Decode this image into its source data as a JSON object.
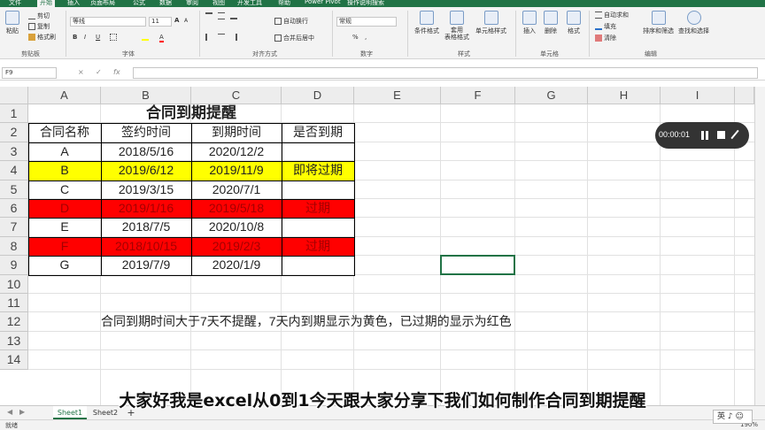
{
  "menu": {
    "tabs": [
      "文件",
      "开始",
      "插入",
      "页面布局",
      "公式",
      "数据",
      "审阅",
      "视图",
      "开发工具",
      "帮助",
      "Power Pivot",
      "操作说明搜索"
    ],
    "active_tab": "开始",
    "accent_color": "#217346"
  },
  "ribbon": {
    "clipboard": {
      "paste": "粘贴",
      "cut": "剪切",
      "copy": "复制",
      "format_painter": "格式刷",
      "label": "剪贴板"
    },
    "font": {
      "name": "等线",
      "size": "11",
      "bold": "B",
      "italic": "I",
      "underline": "U",
      "grow": "A",
      "shrink": "A",
      "color_letter": "A",
      "label": "字体"
    },
    "alignment": {
      "wrap": "自动换行",
      "merge": "合并后居中",
      "label": "对齐方式"
    },
    "number": {
      "format": "常规",
      "percent": "%",
      "comma": ",",
      "label": "数字"
    },
    "styles": {
      "conditional": "条件格式",
      "table": "套用\n表格格式",
      "cell_styles": "单元格样式",
      "label": "样式"
    },
    "cells": {
      "insert": "插入",
      "delete": "删除",
      "format": "格式",
      "label": "单元格"
    },
    "editing": {
      "autosum": "自动求和",
      "fill": "填充",
      "clear": "清除",
      "sort": "排序和筛选",
      "find": "查找和选择",
      "label": "编辑"
    }
  },
  "formula_bar": {
    "name_box": "F9",
    "cancel": "×",
    "enter": "✓",
    "fx": "fx",
    "value": ""
  },
  "columns": [
    "A",
    "B",
    "C",
    "D",
    "E",
    "F",
    "G",
    "H",
    "I"
  ],
  "rows": [
    "1",
    "2",
    "3",
    "4",
    "5",
    "6",
    "7",
    "8",
    "9",
    "10",
    "11",
    "12",
    "13",
    "14"
  ],
  "sheet": {
    "title": "合同到期提醒",
    "headers": [
      "合同名称",
      "签约时间",
      "到期时间",
      "是否到期"
    ],
    "records": [
      {
        "name": "A",
        "sign": "2018/5/16",
        "expire": "2020/12/2",
        "status": "",
        "fill": "none"
      },
      {
        "name": "B",
        "sign": "2019/6/12",
        "expire": "2019/11/9",
        "status": "即将过期",
        "fill": "yellow"
      },
      {
        "name": "C",
        "sign": "2019/3/15",
        "expire": "2020/7/1",
        "status": "",
        "fill": "none"
      },
      {
        "name": "D",
        "sign": "2019/1/16",
        "expire": "2019/5/18",
        "status": "过期",
        "fill": "red"
      },
      {
        "name": "E",
        "sign": "2018/7/5",
        "expire": "2020/10/8",
        "status": "",
        "fill": "none"
      },
      {
        "name": "F",
        "sign": "2018/10/15",
        "expire": "2019/2/3",
        "status": "过期",
        "fill": "red"
      },
      {
        "name": "G",
        "sign": "2019/7/9",
        "expire": "2020/1/9",
        "status": "",
        "fill": "none"
      }
    ],
    "note": "合同到期时间大于7天不提醒，7天内到期显示为黄色，已过期的显示为红色",
    "colors": {
      "yellow": "#ffff00",
      "red": "#ff0000"
    }
  },
  "tabs": {
    "sheets": [
      "Sheet1",
      "Sheet2"
    ],
    "active": "Sheet1",
    "add": "+"
  },
  "status": {
    "ready": "就绪",
    "zoom": "190%"
  },
  "recorder": {
    "time": "00:00:01"
  },
  "subtitle": "大家好我是excel从0到1今天跟大家分享下我们如何制作合同到期提醒",
  "ime": "英 ♪ ☺"
}
